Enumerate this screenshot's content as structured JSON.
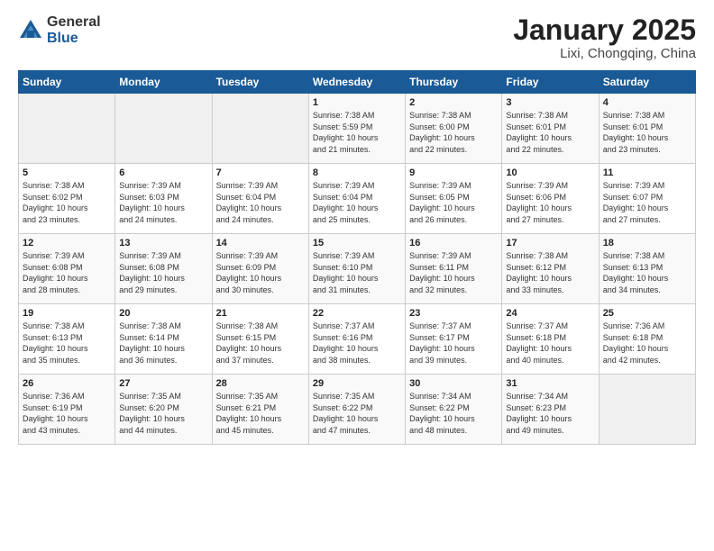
{
  "logo": {
    "general": "General",
    "blue": "Blue"
  },
  "header": {
    "title": "January 2025",
    "subtitle": "Lixi, Chongqing, China"
  },
  "weekdays": [
    "Sunday",
    "Monday",
    "Tuesday",
    "Wednesday",
    "Thursday",
    "Friday",
    "Saturday"
  ],
  "weeks": [
    [
      {
        "day": "",
        "info": ""
      },
      {
        "day": "",
        "info": ""
      },
      {
        "day": "",
        "info": ""
      },
      {
        "day": "1",
        "info": "Sunrise: 7:38 AM\nSunset: 5:59 PM\nDaylight: 10 hours\nand 21 minutes."
      },
      {
        "day": "2",
        "info": "Sunrise: 7:38 AM\nSunset: 6:00 PM\nDaylight: 10 hours\nand 22 minutes."
      },
      {
        "day": "3",
        "info": "Sunrise: 7:38 AM\nSunset: 6:01 PM\nDaylight: 10 hours\nand 22 minutes."
      },
      {
        "day": "4",
        "info": "Sunrise: 7:38 AM\nSunset: 6:01 PM\nDaylight: 10 hours\nand 23 minutes."
      }
    ],
    [
      {
        "day": "5",
        "info": "Sunrise: 7:38 AM\nSunset: 6:02 PM\nDaylight: 10 hours\nand 23 minutes."
      },
      {
        "day": "6",
        "info": "Sunrise: 7:39 AM\nSunset: 6:03 PM\nDaylight: 10 hours\nand 24 minutes."
      },
      {
        "day": "7",
        "info": "Sunrise: 7:39 AM\nSunset: 6:04 PM\nDaylight: 10 hours\nand 24 minutes."
      },
      {
        "day": "8",
        "info": "Sunrise: 7:39 AM\nSunset: 6:04 PM\nDaylight: 10 hours\nand 25 minutes."
      },
      {
        "day": "9",
        "info": "Sunrise: 7:39 AM\nSunset: 6:05 PM\nDaylight: 10 hours\nand 26 minutes."
      },
      {
        "day": "10",
        "info": "Sunrise: 7:39 AM\nSunset: 6:06 PM\nDaylight: 10 hours\nand 27 minutes."
      },
      {
        "day": "11",
        "info": "Sunrise: 7:39 AM\nSunset: 6:07 PM\nDaylight: 10 hours\nand 27 minutes."
      }
    ],
    [
      {
        "day": "12",
        "info": "Sunrise: 7:39 AM\nSunset: 6:08 PM\nDaylight: 10 hours\nand 28 minutes."
      },
      {
        "day": "13",
        "info": "Sunrise: 7:39 AM\nSunset: 6:08 PM\nDaylight: 10 hours\nand 29 minutes."
      },
      {
        "day": "14",
        "info": "Sunrise: 7:39 AM\nSunset: 6:09 PM\nDaylight: 10 hours\nand 30 minutes."
      },
      {
        "day": "15",
        "info": "Sunrise: 7:39 AM\nSunset: 6:10 PM\nDaylight: 10 hours\nand 31 minutes."
      },
      {
        "day": "16",
        "info": "Sunrise: 7:39 AM\nSunset: 6:11 PM\nDaylight: 10 hours\nand 32 minutes."
      },
      {
        "day": "17",
        "info": "Sunrise: 7:38 AM\nSunset: 6:12 PM\nDaylight: 10 hours\nand 33 minutes."
      },
      {
        "day": "18",
        "info": "Sunrise: 7:38 AM\nSunset: 6:13 PM\nDaylight: 10 hours\nand 34 minutes."
      }
    ],
    [
      {
        "day": "19",
        "info": "Sunrise: 7:38 AM\nSunset: 6:13 PM\nDaylight: 10 hours\nand 35 minutes."
      },
      {
        "day": "20",
        "info": "Sunrise: 7:38 AM\nSunset: 6:14 PM\nDaylight: 10 hours\nand 36 minutes."
      },
      {
        "day": "21",
        "info": "Sunrise: 7:38 AM\nSunset: 6:15 PM\nDaylight: 10 hours\nand 37 minutes."
      },
      {
        "day": "22",
        "info": "Sunrise: 7:37 AM\nSunset: 6:16 PM\nDaylight: 10 hours\nand 38 minutes."
      },
      {
        "day": "23",
        "info": "Sunrise: 7:37 AM\nSunset: 6:17 PM\nDaylight: 10 hours\nand 39 minutes."
      },
      {
        "day": "24",
        "info": "Sunrise: 7:37 AM\nSunset: 6:18 PM\nDaylight: 10 hours\nand 40 minutes."
      },
      {
        "day": "25",
        "info": "Sunrise: 7:36 AM\nSunset: 6:18 PM\nDaylight: 10 hours\nand 42 minutes."
      }
    ],
    [
      {
        "day": "26",
        "info": "Sunrise: 7:36 AM\nSunset: 6:19 PM\nDaylight: 10 hours\nand 43 minutes."
      },
      {
        "day": "27",
        "info": "Sunrise: 7:35 AM\nSunset: 6:20 PM\nDaylight: 10 hours\nand 44 minutes."
      },
      {
        "day": "28",
        "info": "Sunrise: 7:35 AM\nSunset: 6:21 PM\nDaylight: 10 hours\nand 45 minutes."
      },
      {
        "day": "29",
        "info": "Sunrise: 7:35 AM\nSunset: 6:22 PM\nDaylight: 10 hours\nand 47 minutes."
      },
      {
        "day": "30",
        "info": "Sunrise: 7:34 AM\nSunset: 6:22 PM\nDaylight: 10 hours\nand 48 minutes."
      },
      {
        "day": "31",
        "info": "Sunrise: 7:34 AM\nSunset: 6:23 PM\nDaylight: 10 hours\nand 49 minutes."
      },
      {
        "day": "",
        "info": ""
      }
    ]
  ]
}
